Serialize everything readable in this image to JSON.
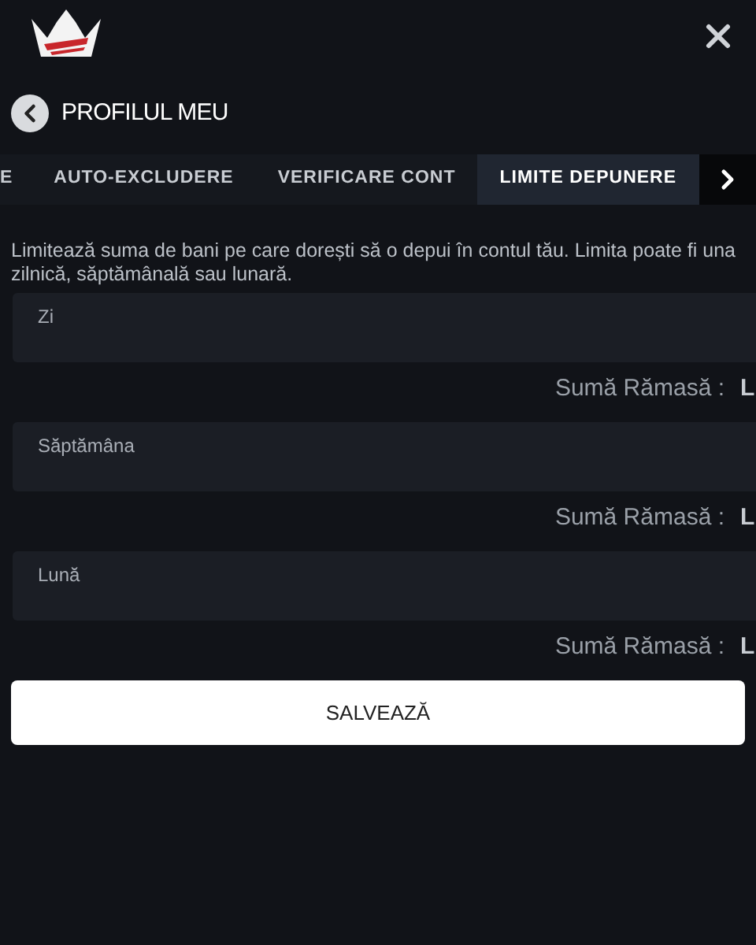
{
  "header": {
    "title": "PROFILUL MEU"
  },
  "tabs": [
    {
      "label": "E",
      "selected": false
    },
    {
      "label": "AUTO-EXCLUDERE",
      "selected": false
    },
    {
      "label": "VERIFICARE CONT",
      "selected": false
    },
    {
      "label": "LIMITE DEPUNERE",
      "selected": true
    }
  ],
  "description": "Limitează suma de bani pe care dorești să o depui în contul tău. Limita poate fi una zilnică, săptămânală sau lunară.",
  "limits": [
    {
      "placeholder": "Zi",
      "remaining_label": "Sumă Rămasă :",
      "remaining_value": "L"
    },
    {
      "placeholder": "Săptămâna",
      "remaining_label": "Sumă Rămasă :",
      "remaining_value": "L"
    },
    {
      "placeholder": "Lună",
      "remaining_label": "Sumă Rămasă :",
      "remaining_value": "L"
    }
  ],
  "save_button": "SALVEAZĂ"
}
